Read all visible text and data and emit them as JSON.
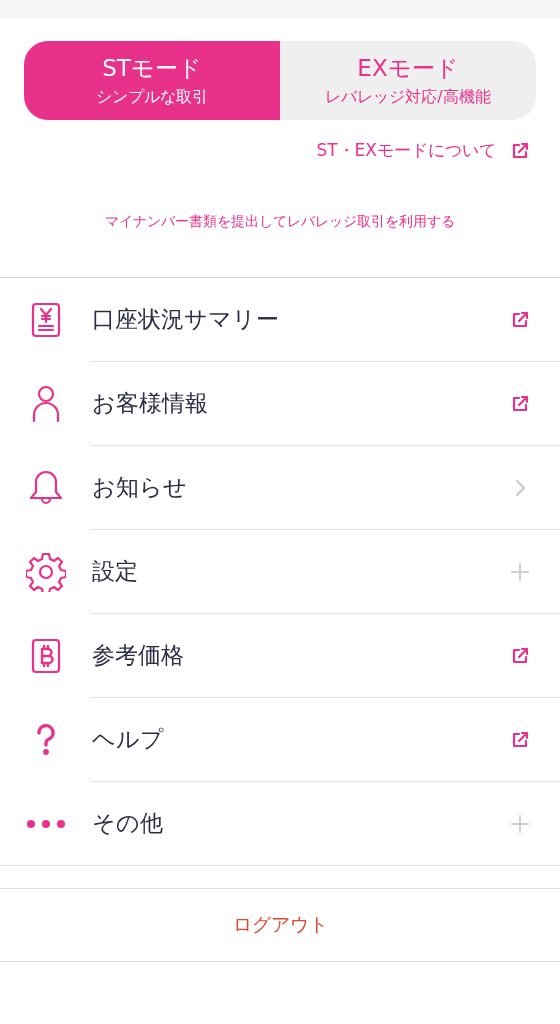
{
  "modes": [
    {
      "title": "STモード",
      "subtitle": "シンプルな取引",
      "selected": true
    },
    {
      "title": "EXモード",
      "subtitle": "レバレッジ対応/高機能",
      "selected": false
    }
  ],
  "mode_info_link": "ST・EXモードについて",
  "notice": "マイナンバー書類を提出してレバレッジ取引を利用する",
  "menu_items": [
    {
      "label": "口座状況サマリー",
      "kind": "external"
    },
    {
      "label": "お客様情報",
      "kind": "external"
    },
    {
      "label": "お知らせ",
      "kind": "navigate"
    },
    {
      "label": "設定",
      "kind": "expand"
    },
    {
      "label": "参考価格",
      "kind": "external"
    },
    {
      "label": "ヘルプ",
      "kind": "external"
    },
    {
      "label": "その他",
      "kind": "expand"
    }
  ],
  "logout": "ログアウト"
}
